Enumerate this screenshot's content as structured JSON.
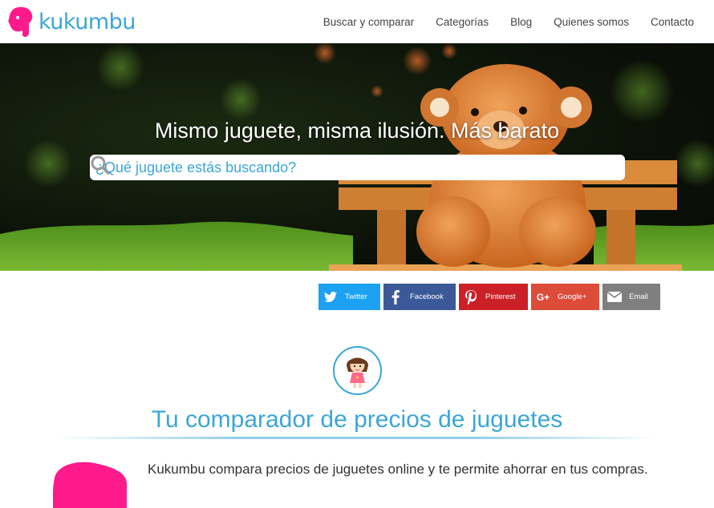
{
  "header": {
    "logo_text": "kukumbu",
    "nav": [
      "Buscar y comparar",
      "Categorías",
      "Blog",
      "Quienes somos",
      "Contacto"
    ]
  },
  "hero": {
    "title": "Mismo juguete, misma ilusión. Más barato",
    "search_placeholder": "¿Qué juguete estás buscando?"
  },
  "share": {
    "twitter": "Twitter",
    "facebook": "Facebook",
    "pinterest": "Pinterest",
    "google": "Google+",
    "email": "Email"
  },
  "main": {
    "title": "Tu comparador de precios de juguetes",
    "intro": "Kukumbu compara precios de juguetes online y te permite ahorrar en tus compras."
  },
  "colors": {
    "accent": "#3ba6d8",
    "brand_pink": "#ff1a8c",
    "twitter": "#1da1f2",
    "facebook": "#3b5998",
    "pinterest": "#cb2027",
    "google": "#dd4b39",
    "email": "#7f7f7f"
  },
  "icons": {
    "logo": "pink-elephant-icon",
    "search": "search-icon",
    "doll": "doll-icon"
  }
}
